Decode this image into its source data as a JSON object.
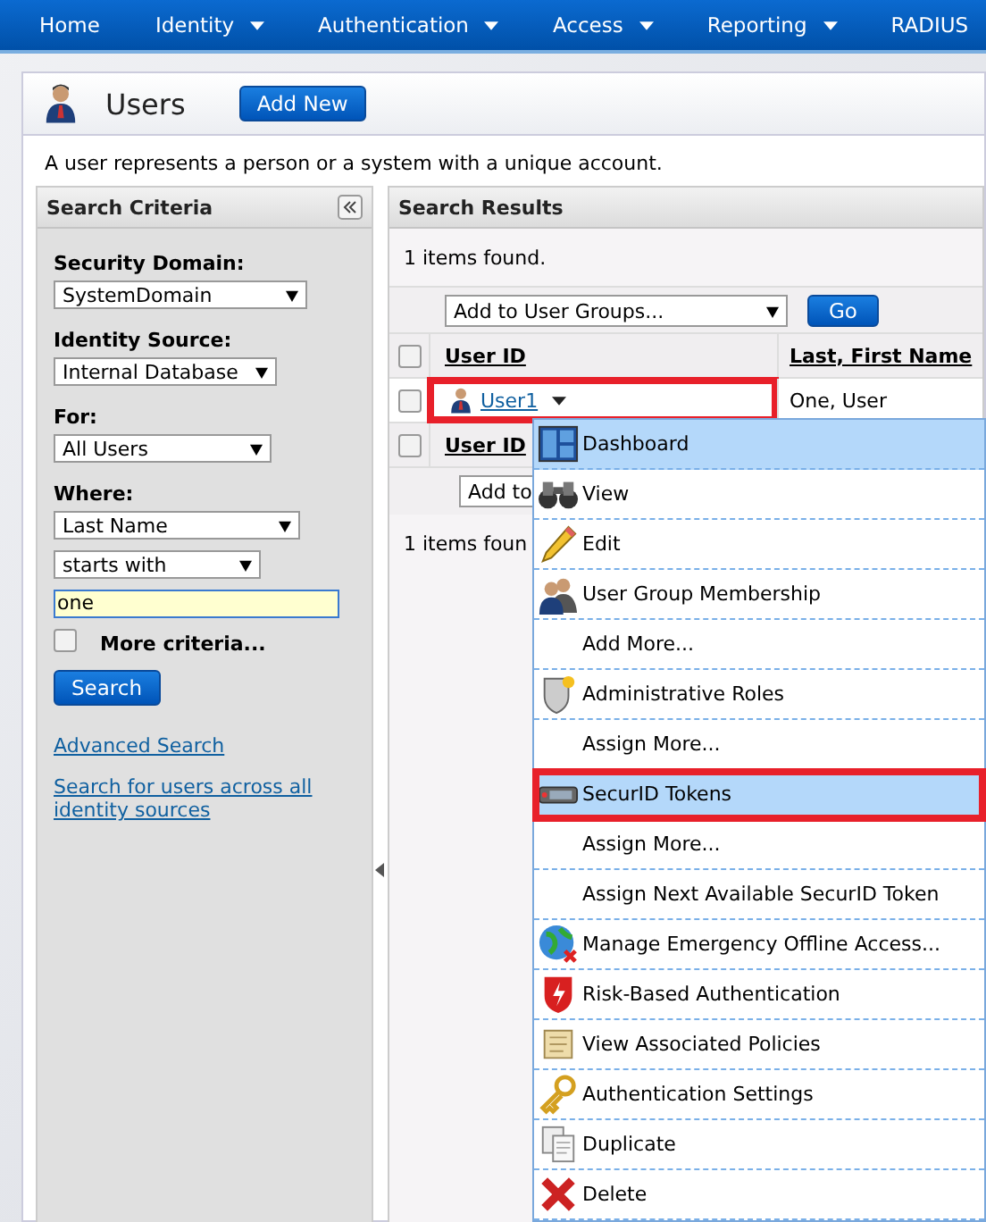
{
  "nav": [
    {
      "label": "Home",
      "dropdown": false
    },
    {
      "label": "Identity",
      "dropdown": true
    },
    {
      "label": "Authentication",
      "dropdown": true
    },
    {
      "label": "Access",
      "dropdown": true
    },
    {
      "label": "Reporting",
      "dropdown": true
    },
    {
      "label": "RADIUS",
      "dropdown": false
    }
  ],
  "page": {
    "title": "Users",
    "add_button": "Add New",
    "description": "A user represents a person or a system with a unique account."
  },
  "search_criteria": {
    "title": "Search Criteria",
    "fields": [
      {
        "label": "Security Domain:",
        "value": "SystemDomain",
        "kind": "select"
      },
      {
        "label": "Identity Source:",
        "value": "Internal Database",
        "kind": "select"
      },
      {
        "label": "For:",
        "value": "All Users",
        "kind": "select"
      },
      {
        "label": "Where:",
        "value": "Last Name",
        "kind": "select"
      },
      {
        "value": "starts with",
        "kind": "select"
      },
      {
        "value": "one",
        "kind": "input"
      }
    ],
    "more_criteria": {
      "label": "More criteria...",
      "checked": false
    },
    "search_button": "Search",
    "links": [
      "Advanced Search",
      "Search for users across all identity sources"
    ]
  },
  "search_results": {
    "title": "Search Results",
    "count": "1 items found.",
    "action_select": "Add to User Groups...",
    "go_button": "Go",
    "columns": [
      "User ID",
      "Last, First Name"
    ],
    "rows": [
      {
        "user_id": "User1",
        "name": "One, User",
        "checked": false,
        "annotated": true
      }
    ],
    "header_checked": false,
    "footer_header_checked": false,
    "footer_header": "User ID",
    "footer_select": "Add to",
    "footer_count": "1 items foun"
  },
  "context_menu": [
    {
      "label": "Dashboard",
      "kind": "action",
      "highlighted": true,
      "annotated": false
    },
    {
      "label": "View",
      "kind": "action",
      "highlighted": false,
      "annotated": false
    },
    {
      "label": "Edit",
      "kind": "action",
      "highlighted": false,
      "annotated": false
    },
    {
      "label": "User Group Membership",
      "kind": "action",
      "highlighted": false,
      "annotated": false
    },
    {
      "label": "Add More...",
      "kind": "sub",
      "highlighted": false,
      "annotated": false
    },
    {
      "label": "Administrative Roles",
      "kind": "action",
      "highlighted": false,
      "annotated": false
    },
    {
      "label": "Assign More...",
      "kind": "sub",
      "highlighted": false,
      "annotated": false
    },
    {
      "label": "SecurID Tokens",
      "kind": "action",
      "highlighted": true,
      "annotated": true
    },
    {
      "label": "Assign More...",
      "kind": "sub",
      "highlighted": false,
      "annotated": false
    },
    {
      "label": "Assign Next Available SecurID Token",
      "kind": "sub",
      "highlighted": false,
      "annotated": false
    },
    {
      "label": "Manage Emergency Offline Access...",
      "kind": "action",
      "highlighted": false,
      "annotated": false
    },
    {
      "label": "Risk-Based Authentication",
      "kind": "action",
      "highlighted": false,
      "annotated": false
    },
    {
      "label": "View Associated Policies",
      "kind": "action",
      "highlighted": false,
      "annotated": false
    },
    {
      "label": "Authentication Settings",
      "kind": "action",
      "highlighted": false,
      "annotated": false
    },
    {
      "label": "Duplicate",
      "kind": "action",
      "highlighted": false,
      "annotated": false
    },
    {
      "label": "Delete",
      "kind": "action",
      "highlighted": false,
      "annotated": false
    }
  ]
}
